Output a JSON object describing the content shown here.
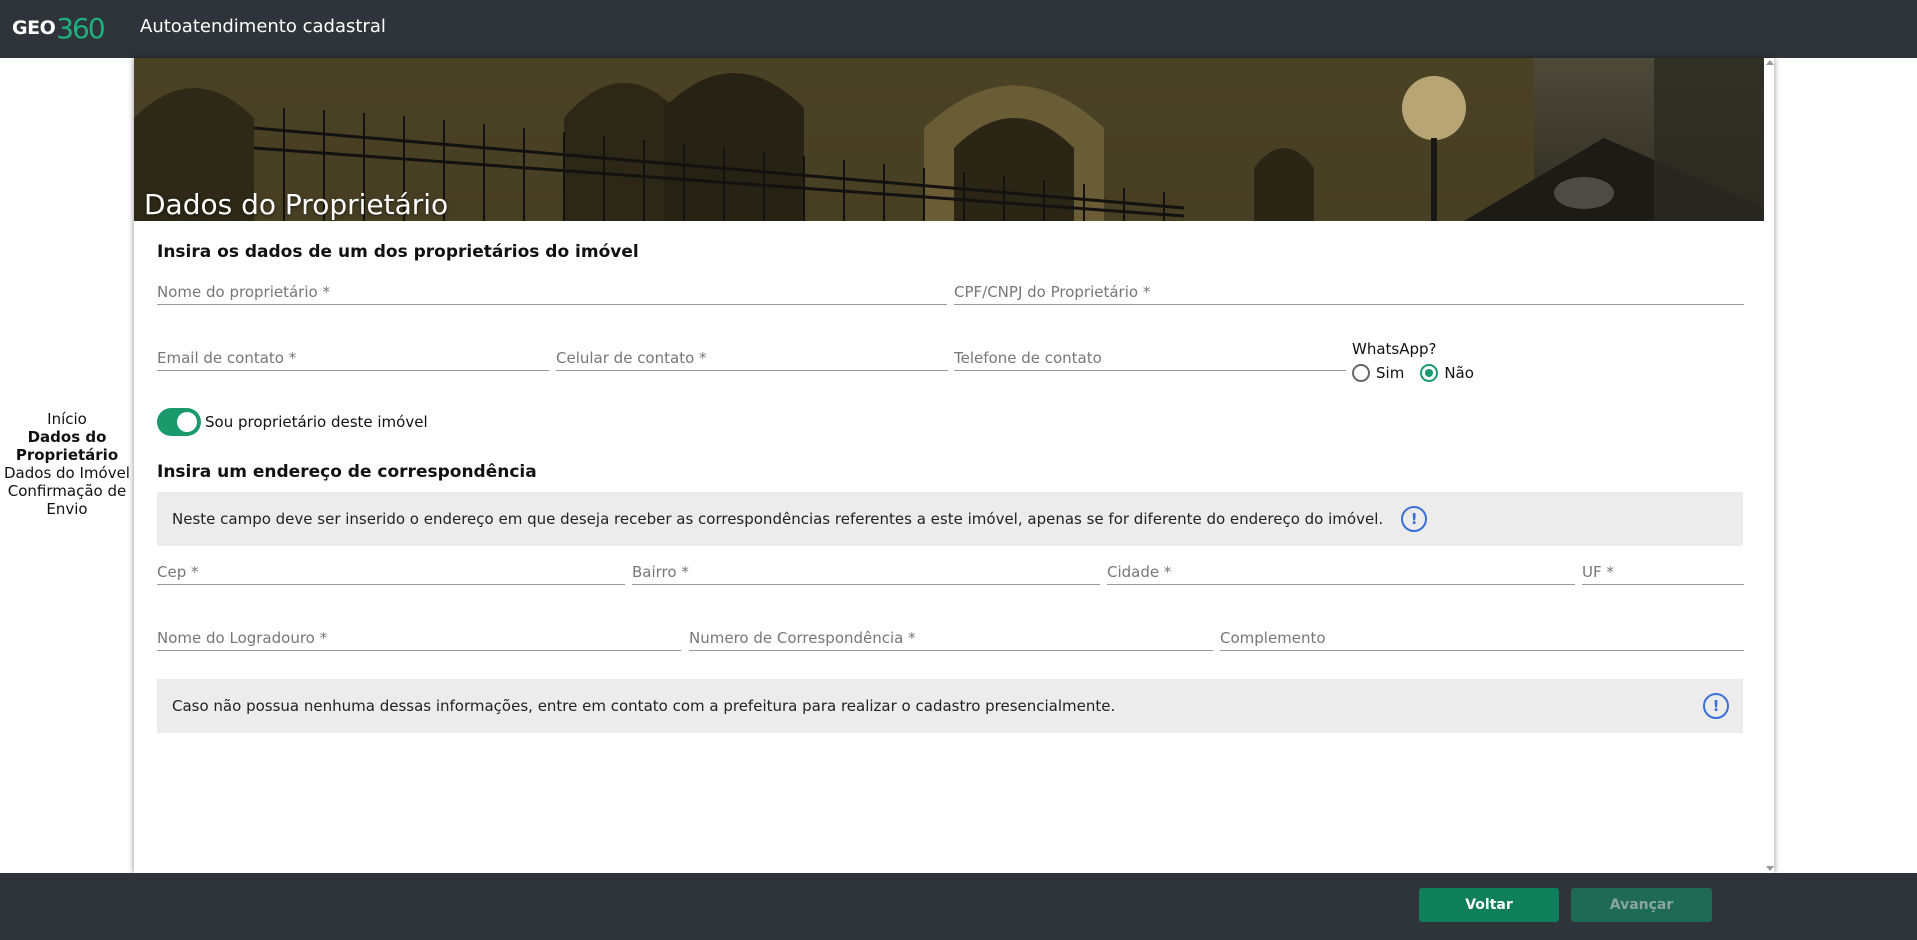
{
  "header": {
    "logo_text": "GEO",
    "logo_num": "360",
    "title": "Autoatendimento cadastral"
  },
  "stepper": {
    "steps": [
      "Início",
      "Dados do Proprietário",
      "Dados do Imóvel",
      "Confirmação de Envio"
    ],
    "active_index": 1
  },
  "hero": {
    "title": "Dados do Proprietário"
  },
  "owner_section": {
    "title": "Insira os dados de um dos proprietários do imóvel",
    "name_placeholder": "Nome do proprietário *",
    "doc_placeholder": "CPF/CNPJ do Proprietário *",
    "email_placeholder": "Email de contato *",
    "cell_placeholder": "Celular de contato *",
    "phone_placeholder": "Telefone de contato",
    "whatsapp_label": "WhatsApp?",
    "whatsapp_yes": "Sim",
    "whatsapp_no": "Não",
    "whatsapp_selected": "Não",
    "owner_toggle_label": "Sou proprietário deste imóvel",
    "owner_toggle_on": true
  },
  "address_section": {
    "title": "Insira um endereço de correspondência",
    "info_text": "Neste campo deve ser inserido o endereço em que deseja receber as correspondências referentes a este imóvel, apenas se for diferente do endereço do imóvel.",
    "cep_placeholder": "Cep *",
    "bairro_placeholder": "Bairro *",
    "cidade_placeholder": "Cidade *",
    "uf_placeholder": "UF *",
    "logradouro_placeholder": "Nome do Logradouro *",
    "numero_placeholder": "Numero de Correspondência *",
    "complemento_placeholder": "Complemento",
    "notice_text": "Caso não possua nenhuma dessas informações, entre em contato com a prefeitura para realizar o cadastro presencialmente."
  },
  "footer": {
    "back_label": "Voltar",
    "next_label": "Avançar"
  },
  "colors": {
    "header_bg": "#2f343b",
    "accent": "#1a9a6c",
    "info_icon": "#3a6fd6"
  },
  "icons": {
    "info": "info-icon",
    "scroll_up": "chevron-up-icon",
    "scroll_down": "chevron-down-icon"
  }
}
